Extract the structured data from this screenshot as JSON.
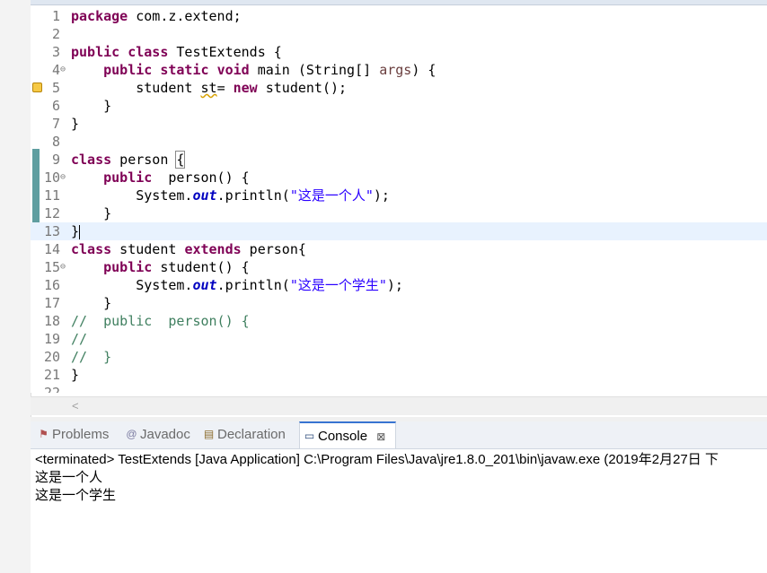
{
  "editor": {
    "lines": [
      {
        "n": "1",
        "html": "<span class='kw'>package</span> com.z.extend;"
      },
      {
        "n": "2",
        "html": ""
      },
      {
        "n": "3",
        "html": "<span class='kw'>public</span> <span class='kw'>class</span> TestExtends {"
      },
      {
        "n": "4",
        "html": "    <span class='kw'>public</span> <span class='kw'>static</span> <span class='kw'>void</span> main (String[] <span class='param'>args</span>) {"
      },
      {
        "n": "5",
        "html": "        student <span class='warnvar'>st</span>= <span class='kw'>new</span> student();"
      },
      {
        "n": "6",
        "html": "    }"
      },
      {
        "n": "7",
        "html": "}"
      },
      {
        "n": "8",
        "html": ""
      },
      {
        "n": "9",
        "html": "<span class='kw'>class</span> person <span class='caret-box'>{</span>"
      },
      {
        "n": "10",
        "html": "    <span class='kw'>public</span>  person() {"
      },
      {
        "n": "11",
        "html": "        System.<span class='fld'>out</span>.println(<span class='str'>\"这是一个人\"</span>);"
      },
      {
        "n": "12",
        "html": "    }"
      },
      {
        "n": "13",
        "html": "}<span class='caret'></span>"
      },
      {
        "n": "14",
        "html": "<span class='kw'>class</span> student <span class='kw'>extends</span> person{"
      },
      {
        "n": "15",
        "html": "    <span class='kw'>public</span> student() {"
      },
      {
        "n": "16",
        "html": "        System.<span class='fld'>out</span>.println(<span class='str'>\"这是一个学生\"</span>);"
      },
      {
        "n": "17",
        "html": "    }"
      },
      {
        "n": "18",
        "html": "<span class='cmt'>//  public  person() {</span>"
      },
      {
        "n": "19",
        "html": "<span class='cmt'>//</span>"
      },
      {
        "n": "20",
        "html": "<span class='cmt'>//  }</span>"
      },
      {
        "n": "21",
        "html": "}"
      },
      {
        "n": "22",
        "html": ""
      }
    ]
  },
  "tabs": [
    {
      "label": "Problems",
      "icon": "problems-icon",
      "glyph": "⚑"
    },
    {
      "label": "Javadoc",
      "icon": "javadoc-icon",
      "glyph": "@"
    },
    {
      "label": "Declaration",
      "icon": "declaration-icon",
      "glyph": "▤"
    },
    {
      "label": "Console",
      "icon": "console-icon",
      "glyph": "▭"
    }
  ],
  "tab_close": "⊠",
  "console": {
    "header": "<terminated> TestExtends [Java Application] C:\\Program Files\\Java\\jre1.8.0_201\\bin\\javaw.exe (2019年2月27日 下",
    "output": [
      "这是一个人",
      "这是一个学生"
    ]
  },
  "scroll_left": "<"
}
